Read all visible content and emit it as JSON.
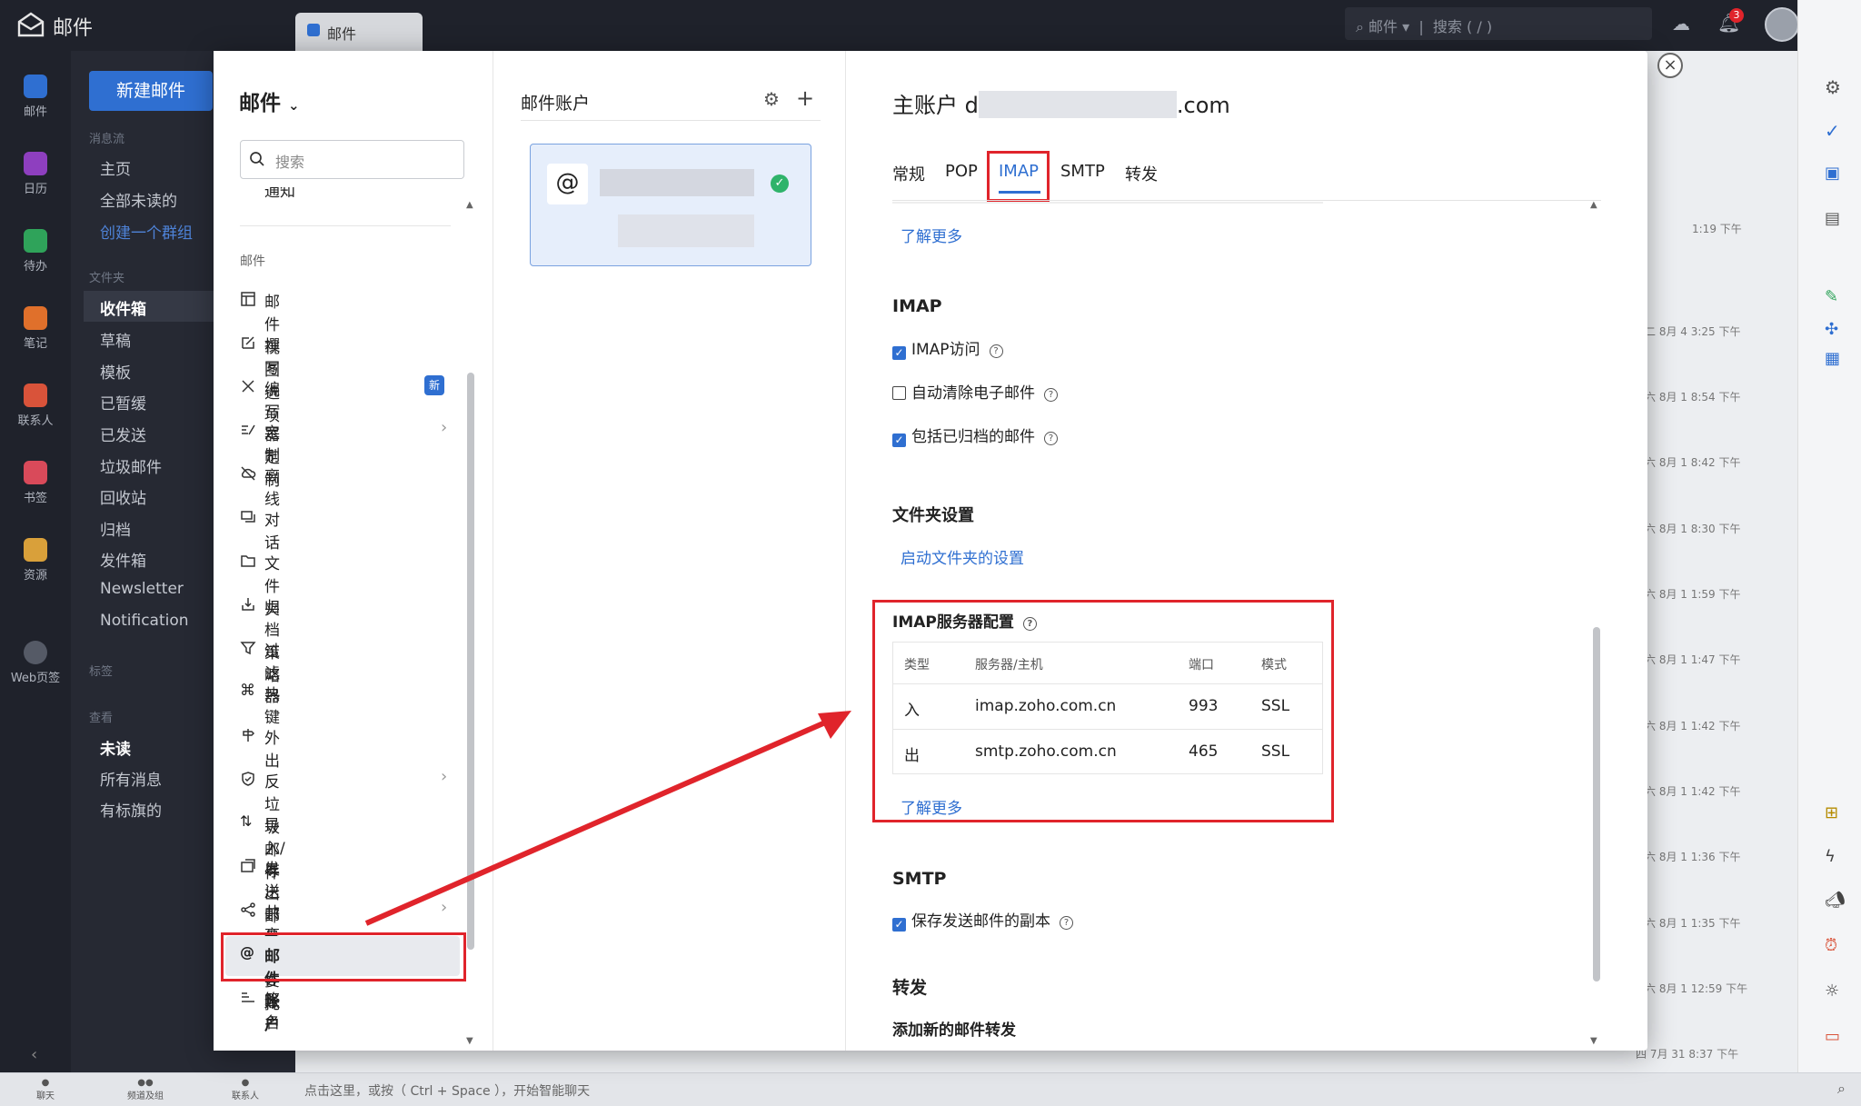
{
  "app": {
    "title": "邮件",
    "tab_label": "邮件",
    "search_scope": "邮件",
    "search_placeholder": "搜索 ( / )",
    "notification_count": "3",
    "new_mail_label": "新建邮件",
    "bottom_hint": "点击这里，或按（ Ctrl + Space ），开始智能聊天"
  },
  "rail": [
    {
      "label": "邮件",
      "color": "#2f6fd1"
    },
    {
      "label": "日历",
      "color": "#8e3fbf"
    },
    {
      "label": "待办",
      "color": "#2fa35a"
    },
    {
      "label": "笔记",
      "color": "#e0702b"
    },
    {
      "label": "联系人",
      "color": "#d9533a"
    },
    {
      "label": "书签",
      "color": "#d94a5a"
    },
    {
      "label": "资源",
      "color": "#d9a03a"
    },
    {
      "label": "Web页签",
      "color": "#555a66"
    }
  ],
  "sidenav": {
    "stream_head": "消息流",
    "stream_items": [
      "主页",
      "全部未读的",
      "创建一个群组"
    ],
    "folder_head": "文件夹",
    "folder_items": [
      "收件箱",
      "草稿",
      "模板",
      "已暂缓",
      "已发送",
      "垃圾邮件",
      "回收站",
      "归档",
      "发件箱",
      "Newsletter",
      "Notification"
    ],
    "tag_head": "标签",
    "view_head": "查看",
    "view_items": [
      "未读",
      "所有消息",
      "有标旗的"
    ]
  },
  "timestamps": [
    "1:19 下午",
    "二 8月 4 3:25 下午",
    "六 8月 1 8:54 下午",
    "六 8月 1 8:42 下午",
    "六 8月 1 8:30 下午",
    "六 8月 1 1:59 下午",
    "六 8月 1 1:47 下午",
    "六 8月 1 1:42 下午",
    "六 8月 1 1:42 下午",
    "六 8月 1 1:36 下午",
    "六 8月 1 1:35 下午",
    "六 8月 1 12:59 下午",
    "四 7月 31 8:37 下午"
  ],
  "bottom_icons": [
    "聊天",
    "频道及组",
    "联系人"
  ],
  "settings": {
    "title": "邮件",
    "search_placeholder": "搜索",
    "partial_item": "通知",
    "section_head": "邮件",
    "new_badge": "新",
    "items": [
      {
        "label": "邮件视图选项",
        "icon": "layout-icon"
      },
      {
        "label": "撰写",
        "icon": "compose-icon"
      },
      {
        "label": "编写器定制",
        "icon": "editor-icon"
      },
      {
        "label": "定制",
        "icon": "customize-icon"
      },
      {
        "label": "离线",
        "icon": "offline-icon"
      },
      {
        "label": "对话",
        "icon": "conversation-icon"
      },
      {
        "label": "文件夹",
        "icon": "folder-icon"
      },
      {
        "label": "归档策略",
        "icon": "archive-icon"
      },
      {
        "label": "过滤器",
        "icon": "filter-icon"
      },
      {
        "label": "热键",
        "icon": "hotkey-icon"
      },
      {
        "label": "外出",
        "icon": "out-of-office-icon"
      },
      {
        "label": "反垃圾邮件",
        "icon": "antispam-icon"
      },
      {
        "label": "导入/导出邮件",
        "icon": "import-export-icon"
      },
      {
        "label": "发送邮件",
        "icon": "send-mail-icon"
      },
      {
        "label": "共享与委托",
        "icon": "share-icon"
      },
      {
        "label": "邮件账户",
        "icon": "at-icon"
      },
      {
        "label": "签名",
        "icon": "signature-icon"
      }
    ]
  },
  "accounts": {
    "title": "邮件账户",
    "at_symbol": "@"
  },
  "detail": {
    "title_prefix": "主账户 d",
    "title_suffix": ".com",
    "tabs": [
      "常规",
      "POP",
      "IMAP",
      "SMTP",
      "转发"
    ],
    "learn_more": "了解更多",
    "imap_head": "IMAP",
    "imap_options": [
      {
        "label": "IMAP访问",
        "checked": true
      },
      {
        "label": "自动清除电子邮件",
        "checked": false
      },
      {
        "label": "包括已归档的邮件",
        "checked": true
      }
    ],
    "folder_head": "文件夹设置",
    "folder_link": "启动文件夹的设置",
    "server_head": "IMAP服务器配置",
    "server_columns": [
      "类型",
      "服务器/主机",
      "端口",
      "模式"
    ],
    "server_rows": [
      {
        "type": "入",
        "host": "imap.zoho.com.cn",
        "port": "993",
        "mode": "SSL"
      },
      {
        "type": "出",
        "host": "smtp.zoho.com.cn",
        "port": "465",
        "mode": "SSL"
      }
    ],
    "smtp_head": "SMTP",
    "smtp_option": "保存发送邮件的副本",
    "forward_head": "转发",
    "forward_sub": "添加新的邮件转发"
  }
}
